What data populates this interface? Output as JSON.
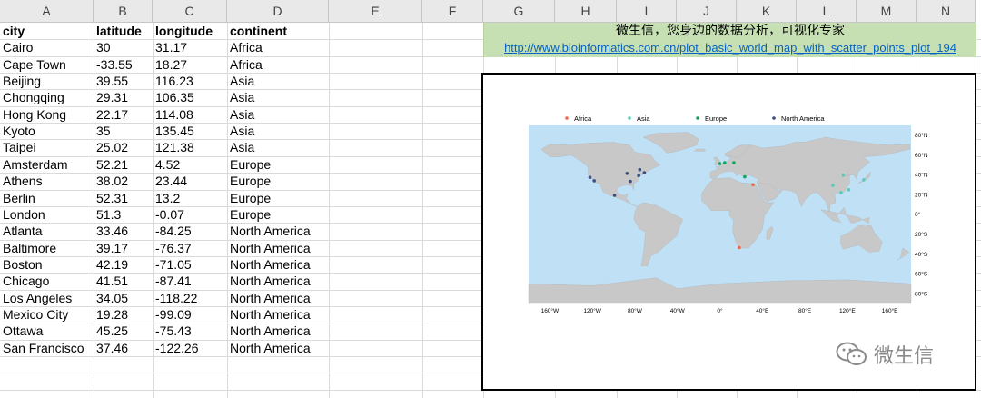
{
  "columns": [
    "A",
    "B",
    "C",
    "D",
    "E",
    "F",
    "G",
    "H",
    "I",
    "J",
    "K",
    "L",
    "M",
    "N"
  ],
  "table": {
    "headers": [
      "city",
      "latitude",
      "longitude",
      "continent"
    ],
    "rows": [
      [
        "Cairo",
        "30",
        "31.17",
        "Africa"
      ],
      [
        "Cape Town",
        "-33.55",
        "18.27",
        "Africa"
      ],
      [
        "Beijing",
        "39.55",
        "116.23",
        "Asia"
      ],
      [
        "Chongqing",
        "29.31",
        "106.35",
        "Asia"
      ],
      [
        "Hong Kong",
        "22.17",
        "114.08",
        "Asia"
      ],
      [
        "Kyoto",
        "35",
        "135.45",
        "Asia"
      ],
      [
        "Taipei",
        "25.02",
        "121.38",
        "Asia"
      ],
      [
        "Amsterdam",
        "52.21",
        "4.52",
        "Europe"
      ],
      [
        "Athens",
        "38.02",
        "23.44",
        "Europe"
      ],
      [
        "Berlin",
        "52.31",
        "13.2",
        "Europe"
      ],
      [
        "London",
        "51.3",
        "-0.07",
        "Europe"
      ],
      [
        "Atlanta",
        "33.46",
        "-84.25",
        "North America"
      ],
      [
        "Baltimore",
        "39.17",
        "-76.37",
        "North America"
      ],
      [
        "Boston",
        "42.19",
        "-71.05",
        "North America"
      ],
      [
        "Chicago",
        "41.51",
        "-87.41",
        "North America"
      ],
      [
        "Los Angeles",
        "34.05",
        "-118.22",
        "North America"
      ],
      [
        "Mexico City",
        "19.28",
        "-99.09",
        "North America"
      ],
      [
        "Ottawa",
        "45.25",
        "-75.43",
        "North America"
      ],
      [
        "San Francisco",
        "37.46",
        "-122.26",
        "North America"
      ]
    ]
  },
  "banner": {
    "title": "微生信，您身边的数据分析，可视化专家",
    "link": "http://www.bioinformatics.com.cn/plot_basic_world_map_with_scatter_points_plot_194"
  },
  "watermark": {
    "text": "微生信",
    "icon": "wechat-icon"
  },
  "colors": {
    "ocean": "#bfe0f5",
    "land": "#c8c8c8",
    "Africa": "#f0694e",
    "Asia": "#55cdb8",
    "Europe": "#16a35a",
    "North America": "#3b4f82"
  },
  "chart_data": {
    "type": "scatter",
    "title": "",
    "legend": [
      "Africa",
      "Asia",
      "Europe",
      "North America"
    ],
    "legend_position": "top",
    "xlim": [
      -180,
      180
    ],
    "ylim": [
      -90,
      90
    ],
    "x_ticks": [
      "160°W",
      "120°W",
      "80°W",
      "40°W",
      "0°",
      "40°E",
      "80°E",
      "120°E",
      "160°E"
    ],
    "x_tick_values": [
      -160,
      -120,
      -80,
      -40,
      0,
      40,
      80,
      120,
      160
    ],
    "y_ticks": [
      "80°S",
      "60°S",
      "40°S",
      "20°S",
      "0°",
      "20°N",
      "40°N",
      "60°N",
      "80°N"
    ],
    "y_tick_values": [
      -80,
      -60,
      -40,
      -20,
      0,
      20,
      40,
      60,
      80
    ],
    "y_axis_side": "right",
    "grid": false
  }
}
